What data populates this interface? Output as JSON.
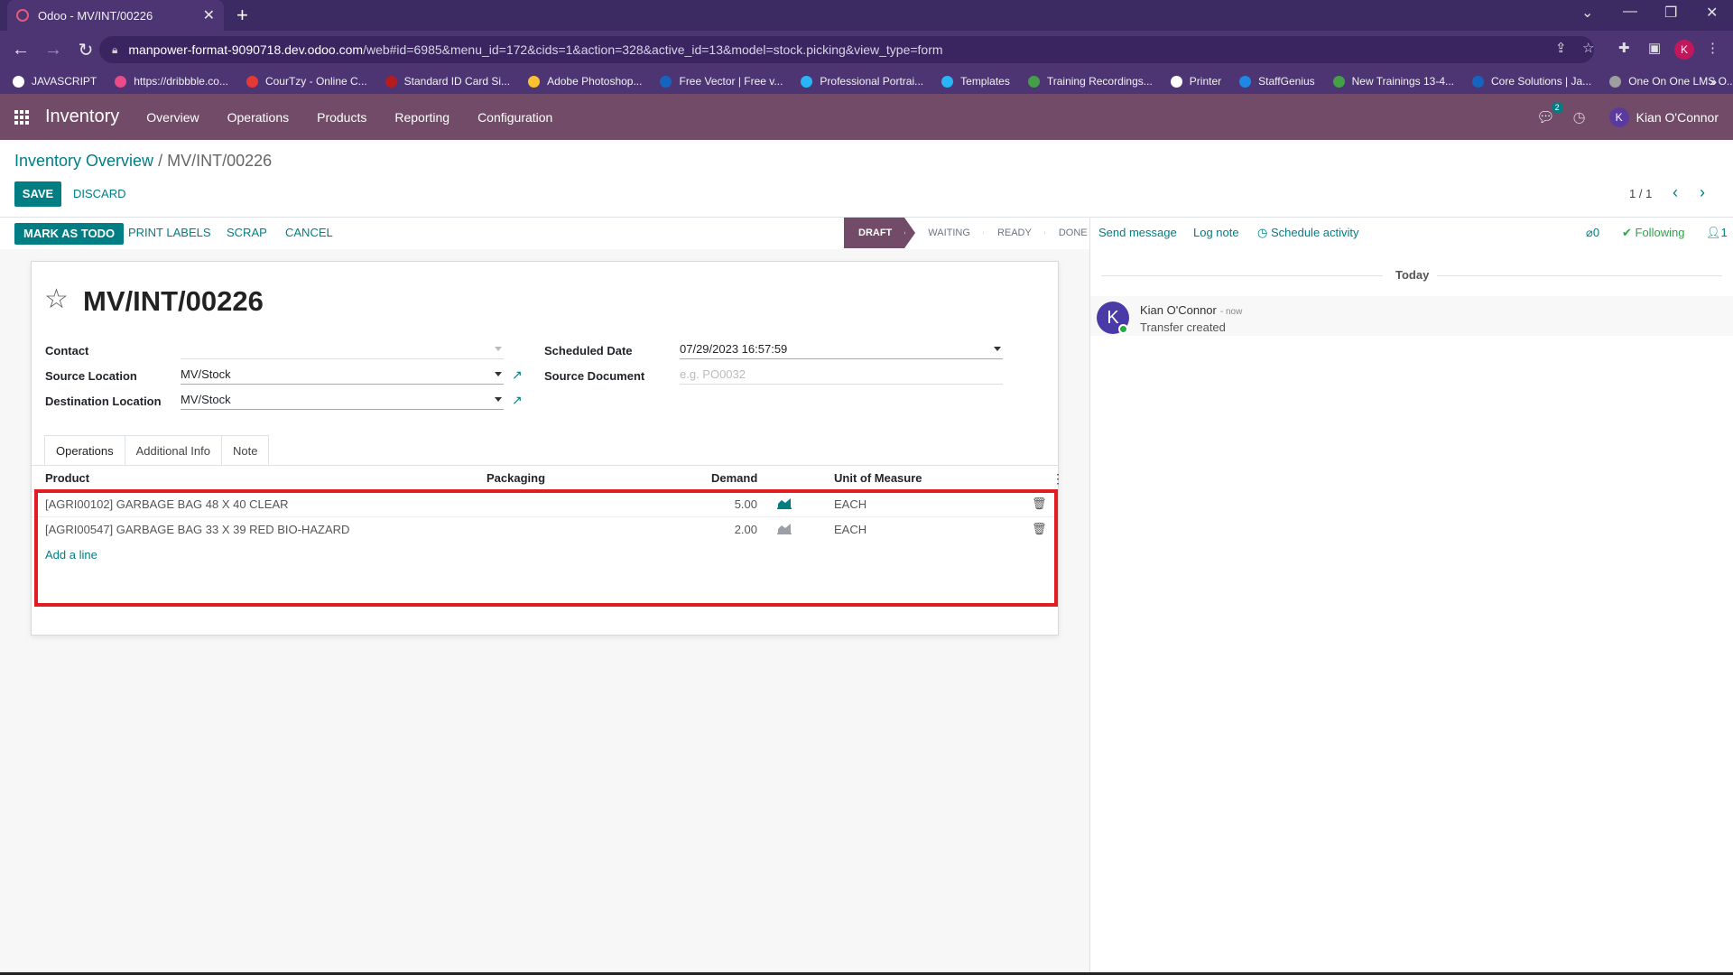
{
  "browser": {
    "tab_title": "Odoo - MV/INT/00226",
    "tab_close": "✕",
    "new_tab": "+",
    "url_host": "manpower-format-9090718.dev.odoo.com",
    "url_path": "/web#id=6985&menu_id=172&cids=1&action=328&active_id=13&model=stock.picking&view_type=form",
    "profile_initial": "K",
    "bookmarks": [
      {
        "label": "JAVASCRIPT",
        "color": "#ffffff"
      },
      {
        "label": "https://dribbble.co...",
        "color": "#ea4c89"
      },
      {
        "label": "CourTzy - Online C...",
        "color": "#e53935"
      },
      {
        "label": "Standard ID Card Si...",
        "color": "#b71c1c"
      },
      {
        "label": "Adobe Photoshop...",
        "color": "#fbc02d"
      },
      {
        "label": "Free Vector | Free v...",
        "color": "#1565c0"
      },
      {
        "label": "Professional Portrai...",
        "color": "#29b6f6"
      },
      {
        "label": "Templates",
        "color": "#29b6f6"
      },
      {
        "label": "Training Recordings...",
        "color": "#43a047"
      },
      {
        "label": "Printer",
        "color": "#ffffff"
      },
      {
        "label": "StaffGenius",
        "color": "#1e88e5"
      },
      {
        "label": "New Trainings 13-4...",
        "color": "#43a047"
      },
      {
        "label": "Core Solutions | Ja...",
        "color": "#1565c0"
      },
      {
        "label": "One On One LMS O...",
        "color": "#9e9e9e"
      }
    ],
    "bookmarks_more": "»"
  },
  "navbar": {
    "app_name": "Inventory",
    "menus": [
      "Overview",
      "Operations",
      "Products",
      "Reporting",
      "Configuration"
    ],
    "chat_count": "2",
    "user_initial": "K",
    "user_name": "Kian O'Connor"
  },
  "control": {
    "breadcrumb_parent": "Inventory Overview",
    "breadcrumb_sep": " / ",
    "breadcrumb_current": "MV/INT/00226",
    "save_label": "SAVE",
    "discard_label": "DISCARD",
    "pager": "1 / 1"
  },
  "header": {
    "buttons": [
      "MARK AS TODO",
      "PRINT LABELS",
      "SCRAP",
      "CANCEL"
    ],
    "stages": [
      "DRAFT",
      "WAITING",
      "READY",
      "DONE"
    ],
    "active_stage": "DRAFT"
  },
  "form": {
    "record_name": "MV/INT/00226",
    "contact_label": "Contact",
    "contact_value": "",
    "source_location_label": "Source Location",
    "source_location_value": "MV/Stock",
    "destination_location_label": "Destination Location",
    "destination_location_value": "MV/Stock",
    "scheduled_date_label": "Scheduled Date",
    "scheduled_date_value": "07/29/2023 16:57:59",
    "source_document_label": "Source Document",
    "source_document_placeholder": "e.g. PO0032",
    "tabs": [
      "Operations",
      "Additional Info",
      "Note"
    ],
    "columns": [
      "Product",
      "Packaging",
      "Demand",
      "Unit of Measure"
    ],
    "lines": [
      {
        "product": "[AGRI00102] GARBAGE BAG 48 X 40 CLEAR",
        "packaging": "",
        "demand": "5.00",
        "uom": "EACH"
      },
      {
        "product": "[AGRI00547] GARBAGE BAG 33 X 39 RED BIO-HAZARD",
        "packaging": "",
        "demand": "2.00",
        "uom": "EACH"
      }
    ],
    "add_line": "Add a line"
  },
  "chatter": {
    "send_message": "Send message",
    "log_note": "Log note",
    "schedule_activity": "Schedule activity",
    "attachments_count": "0",
    "following": "Following",
    "followers_count": "1",
    "date_separator": "Today",
    "messages": [
      {
        "author": "Kian O'Connor",
        "time": "- now",
        "body": "Transfer created",
        "initial": "K"
      }
    ]
  },
  "colors": {
    "odoo_primary": "#714b67",
    "odoo_accent": "#017e84",
    "highlight_border": "#e31b23"
  }
}
